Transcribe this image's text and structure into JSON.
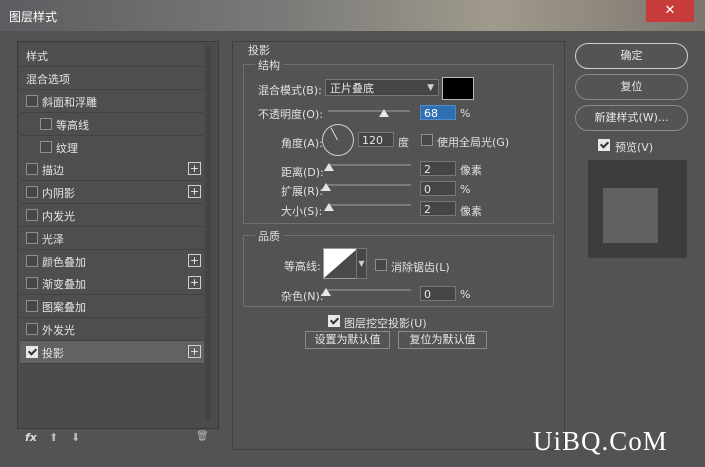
{
  "window": {
    "title": "图层样式",
    "close": "✕"
  },
  "left_panel": {
    "header": "样式",
    "blend_options": "混合选项",
    "items": [
      {
        "label": "斜面和浮雕",
        "checked": false,
        "plus": false
      },
      {
        "label": "等高线",
        "checked": false,
        "plus": false
      },
      {
        "label": "纹理",
        "checked": false,
        "plus": false
      },
      {
        "label": "描边",
        "checked": false,
        "plus": true
      },
      {
        "label": "内阴影",
        "checked": false,
        "plus": true
      },
      {
        "label": "内发光",
        "checked": false,
        "plus": false
      },
      {
        "label": "光泽",
        "checked": false,
        "plus": false
      },
      {
        "label": "颜色叠加",
        "checked": false,
        "plus": true
      },
      {
        "label": "渐变叠加",
        "checked": false,
        "plus": true
      },
      {
        "label": "图案叠加",
        "checked": false,
        "plus": false
      },
      {
        "label": "外发光",
        "checked": false,
        "plus": false
      },
      {
        "label": "投影",
        "checked": true,
        "plus": true
      }
    ],
    "plus_glyph": "+",
    "footer": {
      "fx": "fx",
      "up": "⬆",
      "down": "⬇",
      "trash": "🗑"
    }
  },
  "drop_shadow": {
    "section_title": "投影",
    "structure_title": "结构",
    "blend_mode_label": "混合模式(B):",
    "blend_mode_value": "正片叠底",
    "shadow_color": "#000000",
    "opacity_label": "不透明度(O):",
    "opacity_value": "68",
    "opacity_fraction": 0.68,
    "percent": "%",
    "angle_label": "角度(A):",
    "angle_value": "120",
    "angle_unit": "度",
    "global_light_label": "使用全局光(G)",
    "global_light_checked": false,
    "distance_label": "距离(D):",
    "distance_value": "2",
    "distance_unit": "像素",
    "spread_label": "扩展(R):",
    "spread_value": "0",
    "spread_unit": "%",
    "size_label": "大小(S):",
    "size_value": "2",
    "size_unit": "像素",
    "quality_title": "品质",
    "contour_label": "等高线:",
    "anti_alias_label": "消除锯齿(L)",
    "anti_alias_checked": false,
    "noise_label": "杂色(N):",
    "noise_value": "0",
    "noise_unit": "%",
    "knockout_label": "图层挖空投影(U)",
    "knockout_checked": true,
    "make_default": "设置为默认值",
    "reset_default": "复位为默认值"
  },
  "right_panel": {
    "ok": "确定",
    "reset": "复位",
    "new_style": "新建样式(W)...",
    "preview_label": "预览(V)",
    "preview_checked": true
  },
  "watermark": "UiBQ.CoM"
}
